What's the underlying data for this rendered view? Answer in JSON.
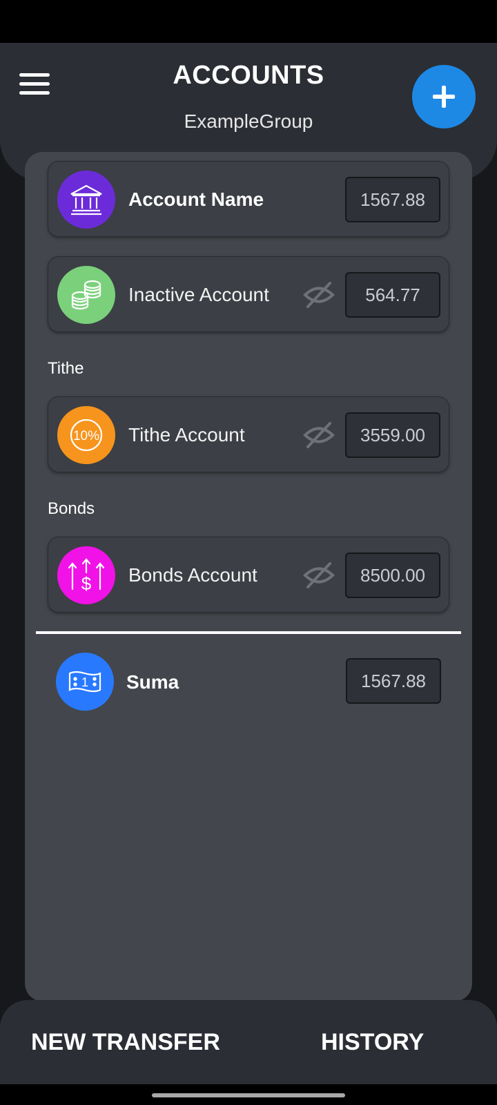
{
  "header": {
    "title": "ACCOUNTS",
    "subtitle": "ExampleGroup"
  },
  "accounts": [
    {
      "name": "Account Name",
      "amount": "1567.88",
      "icon": "bank-icon",
      "color": "#6c2bd9",
      "bold": true,
      "hidden": false
    },
    {
      "name": "Inactive Account",
      "amount": "564.77",
      "icon": "coins-icon",
      "color": "#7bd17b",
      "bold": false,
      "hidden": true
    }
  ],
  "sections": [
    {
      "label": "Tithe",
      "accounts": [
        {
          "name": "Tithe Account",
          "amount": "3559.00",
          "icon": "percent-icon",
          "icon_text": "10%",
          "color": "#f7941d",
          "hidden": true
        }
      ]
    },
    {
      "label": "Bonds",
      "accounts": [
        {
          "name": "Bonds Account",
          "amount": "8500.00",
          "icon": "dollar-arrows-icon",
          "icon_text": "$",
          "color": "#f012e6",
          "hidden": true
        }
      ]
    }
  ],
  "summary": {
    "label": "Suma",
    "amount": "1567.88",
    "icon": "banknote-icon",
    "icon_text": "1",
    "color": "#2979ff"
  },
  "bottom_nav": {
    "new_transfer": "NEW TRANSFER",
    "history": "HISTORY"
  }
}
